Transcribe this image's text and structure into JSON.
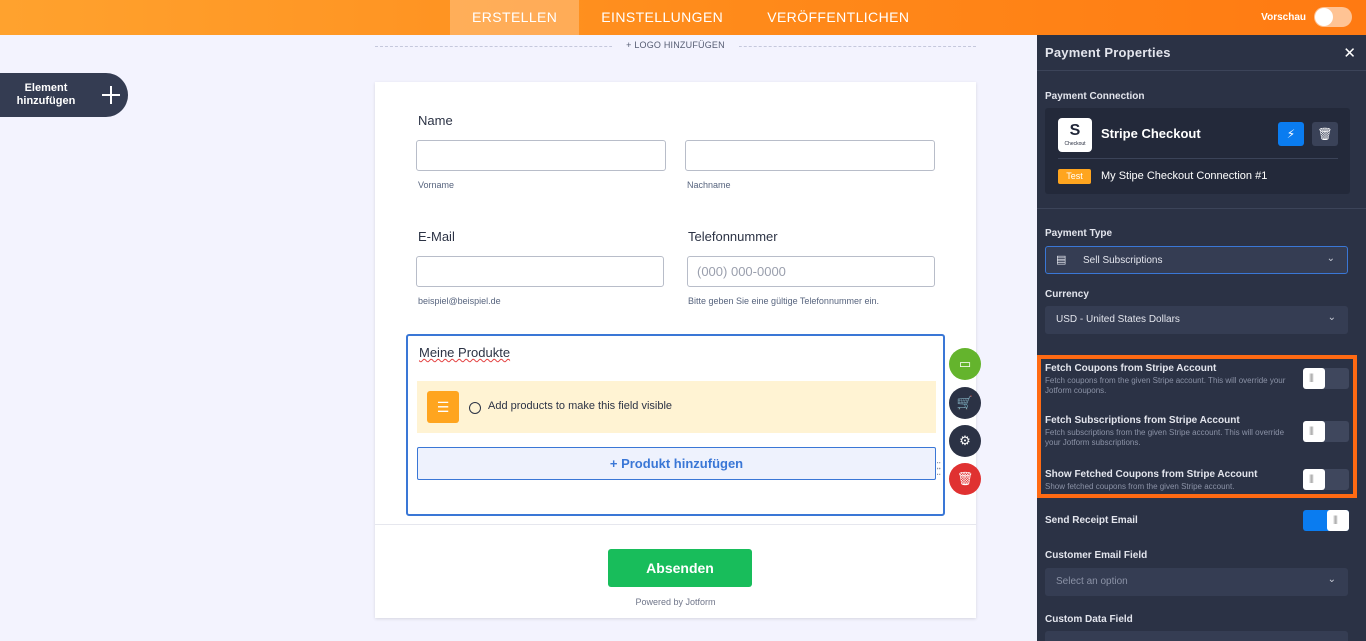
{
  "topbar": {
    "tabs": [
      {
        "label": "ERSTELLEN",
        "active": true
      },
      {
        "label": "EINSTELLUNGEN",
        "active": false
      },
      {
        "label": "VERÖFFENTLICHEN",
        "active": false
      }
    ],
    "preview_label": "Vorschau"
  },
  "sidebar": {
    "add_element_label": "Element hinzufügen"
  },
  "form": {
    "logo_label": "+ LOGO HINZUFÜGEN",
    "name_label": "Name",
    "first_name_sublabel": "Vorname",
    "last_name_sublabel": "Nachname",
    "email_label": "E-Mail",
    "email_sublabel": "beispiel@beispiel.de",
    "phone_label": "Telefonnummer",
    "phone_placeholder": "(000) 000-0000",
    "phone_sublabel": "Bitte geben Sie eine gültige Telefonnummer ein.",
    "products_title": "Meine Produkte",
    "products_notice": "Add products to make this field visible",
    "add_product_label": "+ Produkt hinzufügen",
    "submit_label": "Absenden",
    "powered_by": "Powered by Jotform"
  },
  "panel": {
    "title": "Payment Properties",
    "connection_label": "Payment Connection",
    "gateway_logo_letter": "S",
    "gateway_logo_sub": "Checkout",
    "gateway_name": "Stripe Checkout",
    "mode_badge": "Test",
    "connection_name": "My Stipe Checkout Connection #1",
    "payment_type_label": "Payment Type",
    "payment_type_value": "Sell Subscriptions",
    "currency_label": "Currency",
    "currency_value": "USD - United States Dollars",
    "options": [
      {
        "title": "Fetch Coupons from Stripe Account",
        "desc": "Fetch coupons from the given Stripe account. This will override your Jotform coupons.",
        "on": false
      },
      {
        "title": "Fetch Subscriptions from Stripe Account",
        "desc": "Fetch subscriptions from the given Stripe account. This will override your Jotform subscriptions.",
        "on": false
      },
      {
        "title": "Show Fetched Coupons from Stripe Account",
        "desc": "Show fetched coupons from the given Stripe account.",
        "on": false
      }
    ],
    "receipt_label": "Send Receipt Email",
    "receipt_on": true,
    "customer_email_label": "Customer Email Field",
    "customer_email_placeholder": "Select an option",
    "custom_data_label": "Custom Data Field"
  },
  "colors": {
    "accent_orange": "#ff7a12",
    "primary_blue": "#0a7cf0",
    "submit_green": "#18bd5b",
    "panel_bg": "#2b3245"
  }
}
